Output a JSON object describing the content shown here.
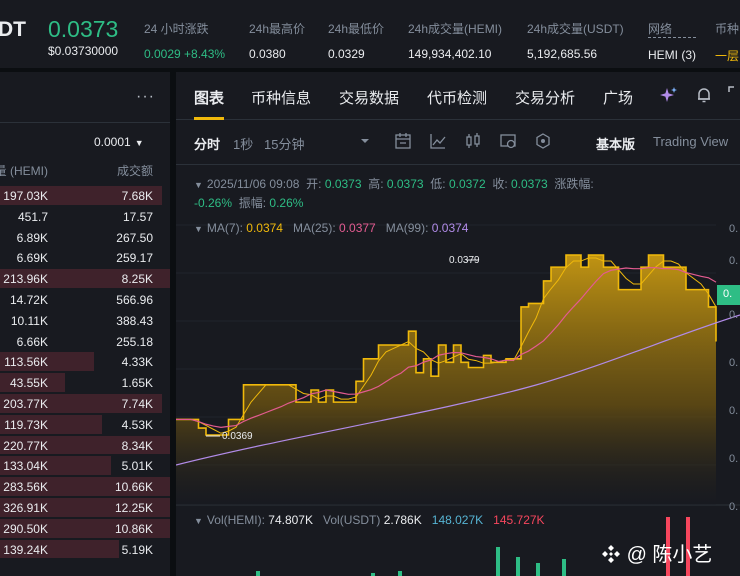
{
  "header": {
    "pair": "DT",
    "price": "0.0373",
    "price_usd": "$0.03730000",
    "stats": [
      {
        "label": "24 小时涨跌",
        "value": "0.0029 +8.43%",
        "tone": "green"
      },
      {
        "label": "24h最高价",
        "value": "0.0380",
        "tone": ""
      },
      {
        "label": "24h最低价",
        "value": "0.0329",
        "tone": ""
      },
      {
        "label": "24h成交量(HEMI)",
        "value": "149,934,402.10",
        "tone": ""
      },
      {
        "label": "24h成交量(USDT)",
        "value": "5,192,685.56",
        "tone": ""
      },
      {
        "label": "网络",
        "value": "HEMI (3)",
        "tone": ""
      },
      {
        "label": "币种",
        "value": "一层",
        "tone": "yellow"
      }
    ]
  },
  "orderbook": {
    "more": "···",
    "precision": "0.0001",
    "caret": "▼",
    "col_amount": "量 (HEMI)",
    "col_total": "成交额",
    "rows": [
      {
        "amount": "197.03K",
        "total": "7.68K",
        "depth": 0.95
      },
      {
        "amount": "451.7",
        "total": "17.57",
        "depth": 0.0
      },
      {
        "amount": "6.89K",
        "total": "267.50",
        "depth": 0.0
      },
      {
        "amount": "6.69K",
        "total": "259.17",
        "depth": 0.0
      },
      {
        "amount": "213.96K",
        "total": "8.25K",
        "depth": 1.0
      },
      {
        "amount": "14.72K",
        "total": "566.96",
        "depth": 0.0
      },
      {
        "amount": "10.11K",
        "total": "388.43",
        "depth": 0.0
      },
      {
        "amount": "6.66K",
        "total": "255.18",
        "depth": 0.0
      },
      {
        "amount": "113.56K",
        "total": "4.33K",
        "depth": 0.55
      },
      {
        "amount": "43.55K",
        "total": "1.65K",
        "depth": 0.38
      },
      {
        "amount": "203.77K",
        "total": "7.74K",
        "depth": 0.95
      },
      {
        "amount": "119.73K",
        "total": "4.53K",
        "depth": 0.6
      },
      {
        "amount": "220.77K",
        "total": "8.34K",
        "depth": 1.0
      },
      {
        "amount": "133.04K",
        "total": "5.01K",
        "depth": 0.65
      },
      {
        "amount": "283.56K",
        "total": "10.66K",
        "depth": 1.0
      },
      {
        "amount": "326.91K",
        "total": "12.25K",
        "depth": 1.0
      },
      {
        "amount": "290.50K",
        "total": "10.86K",
        "depth": 1.0
      },
      {
        "amount": "139.24K",
        "total": "5.19K",
        "depth": 0.7
      }
    ]
  },
  "tabs": [
    "图表",
    "币种信息",
    "交易数据",
    "代币检测",
    "交易分析",
    "广场"
  ],
  "toolbar": {
    "timeframes": [
      "分时",
      "1秒",
      "15分钟"
    ],
    "basic": "基本版",
    "tradingview": "Trading View"
  },
  "ohlc": {
    "time": "2025/11/06 09:08",
    "open_label": "开:",
    "open": "0.0373",
    "high_label": "高:",
    "high": "0.0373",
    "low_label": "低:",
    "low": "0.0372",
    "close_label": "收:",
    "close": "0.0373",
    "change_label": "涨跌幅:",
    "change": "-0.26%",
    "amp_label": "振幅:",
    "amp": "0.26%"
  },
  "ma": {
    "ma7_label": "MA(7):",
    "ma7": "0.0374",
    "ma25_label": "MA(25):",
    "ma25": "0.0377",
    "ma99_label": "MA(99):",
    "ma99": "0.0374"
  },
  "volume": {
    "vol_label": "Vol(HEMI):",
    "vol": "74.807K",
    "volu_label": "Vol(USDT)",
    "volu": "2.786K",
    "v1": "148.027K",
    "v2": "145.727K"
  },
  "chart_labels": {
    "high_tag": "0.0379",
    "low_tag": "0.0369"
  },
  "yaxis": [
    "0.",
    "0.",
    "0.",
    "0.",
    "0.",
    "0.",
    "0."
  ],
  "current_price_tag": "0.",
  "watermark": "@ 陈小艺",
  "colors": {
    "up": "#2ebd85",
    "down": "#f6465d",
    "accent": "#f0b90b",
    "ma25": "#e35b90",
    "ma99": "#b18be8"
  },
  "chart_data": {
    "type": "area",
    "series": [
      {
        "values": [
          0.03695,
          0.03695,
          0.03695,
          0.0369,
          0.03686,
          0.03686,
          0.03686,
          0.03695,
          0.03695,
          0.03715,
          0.03715,
          0.03715,
          0.03715,
          0.03715,
          0.03715,
          0.03715,
          0.03705,
          0.03705,
          0.03712,
          0.03705,
          0.03712,
          0.03705,
          0.03705,
          0.03705,
          0.03717,
          0.0373,
          0.0373,
          0.03738,
          0.03738,
          0.03738,
          0.03738,
          0.03746,
          0.03722,
          0.0373,
          0.0372,
          0.03738,
          0.03728,
          0.03738,
          0.03728,
          0.03725,
          0.03725,
          0.03732,
          0.03728,
          0.03728,
          0.0373,
          0.0373,
          0.0376,
          0.03762,
          0.03762,
          0.03775,
          0.03783,
          0.03783,
          0.0379,
          0.0379,
          0.03783,
          0.0379,
          0.0379,
          0.03783,
          0.03783,
          0.0377,
          0.0377,
          0.0377,
          0.03783,
          0.0379,
          0.0379,
          0.03783,
          0.03783,
          0.03783,
          0.0377,
          0.0377,
          0.0377,
          0.0376,
          0.0374
        ]
      }
    ]
  }
}
